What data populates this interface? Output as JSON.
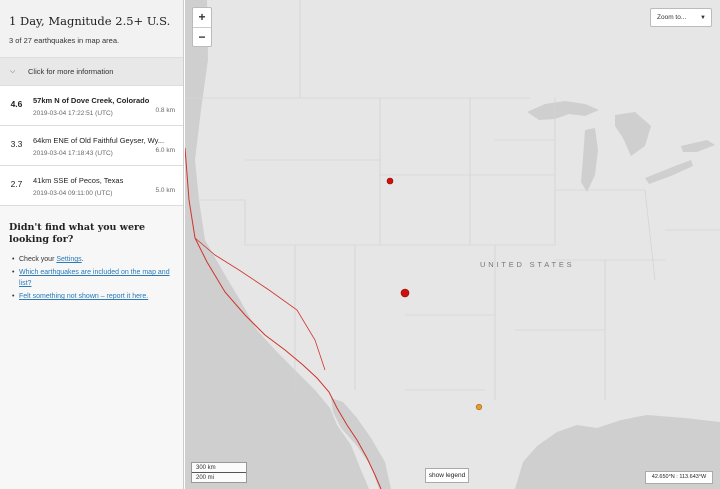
{
  "sidebar": {
    "title": "1 Day, Magnitude 2.5+ U.S.",
    "count_text": "3 of 27 earthquakes in map area.",
    "toggle_label": "Click for more information",
    "earthquakes": [
      {
        "mag": "4.6",
        "place": "57km N of Dove Creek, Colorado",
        "time": "2019-03-04 17:22:51 (UTC)",
        "depth": "0.8 km"
      },
      {
        "mag": "3.3",
        "place": "64km ENE of Old Faithful Geyser, Wy...",
        "time": "2019-03-04 17:18:43 (UTC)",
        "depth": "6.0 km"
      },
      {
        "mag": "2.7",
        "place": "41km SSE of Pecos, Texas",
        "time": "2019-03-04 09:11:00 (UTC)",
        "depth": "5.0 km"
      }
    ],
    "help": {
      "title": "Didn't find what you were looking for?",
      "check_prefix": "Check your ",
      "settings_link": "Settings",
      "check_suffix": ".",
      "link2": "Which earthquakes are included on the map and list?",
      "link3": "Felt something not shown – report it here."
    }
  },
  "map": {
    "zoom_in": "+",
    "zoom_out": "−",
    "zoom_select": "Zoom to...",
    "country_label": "UNITED STATES",
    "scale_km": "300 km",
    "scale_mi": "200 mi",
    "legend_button": "show legend",
    "coords": "42.650°N : 113.643°W",
    "colors": {
      "land": "#e6e6e6",
      "water": "#cfcfcf",
      "fault": "#d0332b",
      "recent": "#d0100e",
      "older": "#e89b2e"
    }
  }
}
